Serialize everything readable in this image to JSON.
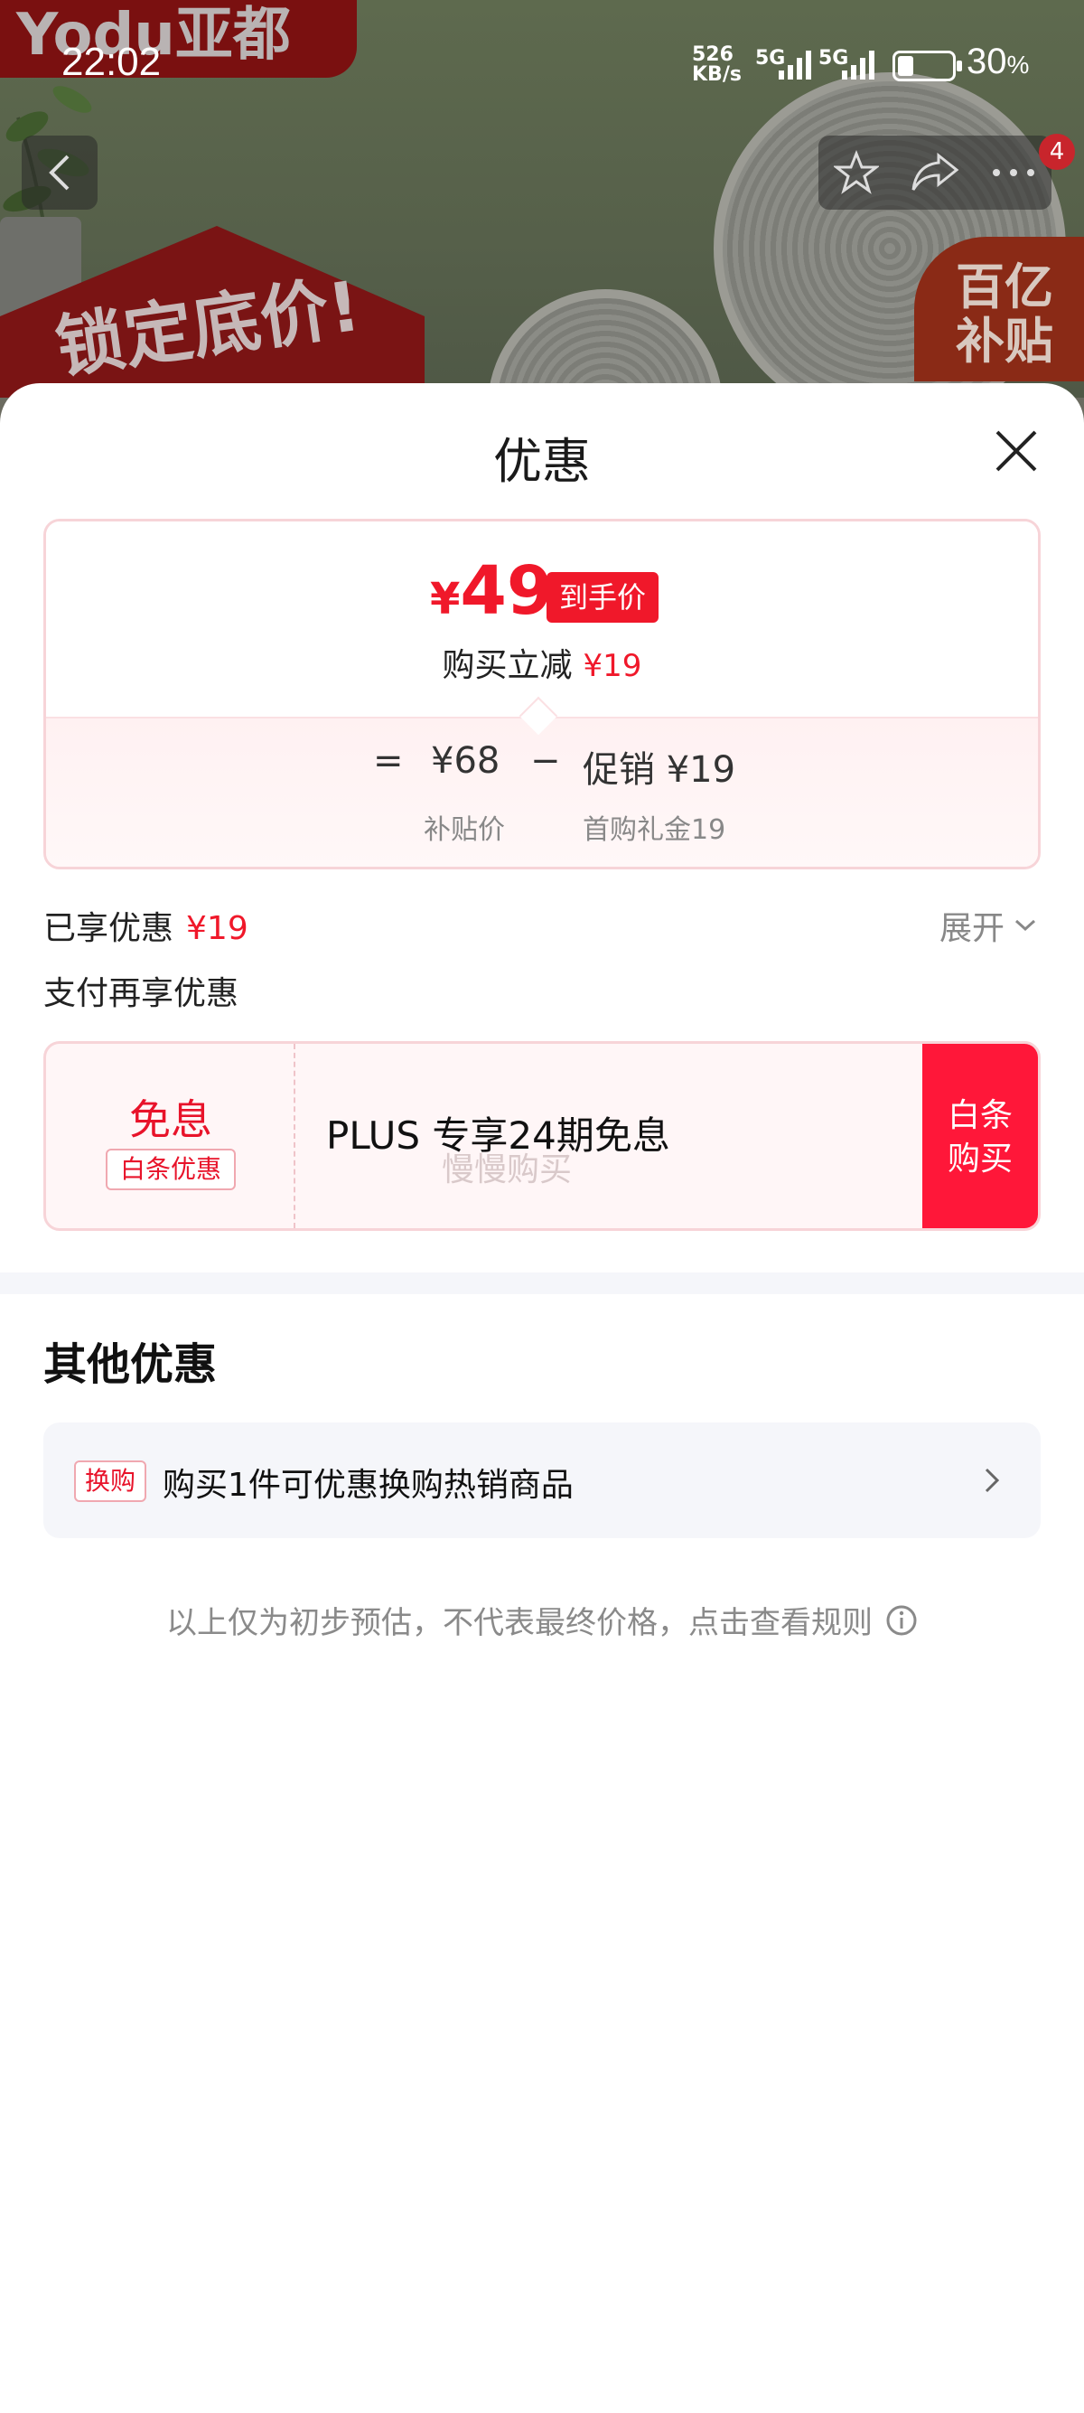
{
  "status_bar": {
    "time": "22:02",
    "net_speed_top": "526",
    "net_speed_bottom": "KB/s",
    "sim1": "5G",
    "sim2": "5G",
    "battery": "30",
    "battery_unit": "%",
    "battery_level": 0.3
  },
  "background": {
    "brand_logo": "Yodu亚都",
    "promo_text": "锁定底价!",
    "subsidy_badge_line1": "百亿",
    "subsidy_badge_line2": "补贴"
  },
  "nav": {
    "cart_badge": "4"
  },
  "sheet": {
    "title": "优惠",
    "price_card": {
      "yen": "¥",
      "final_price": "49",
      "final_tag": "到手价",
      "reduce_label": "购买立减",
      "reduce_amount": "¥19",
      "equals": "=",
      "original_price": "¥68",
      "original_label": "补贴价",
      "minus": "−",
      "promo_label": "促销 ¥19",
      "promo_sub": "首购礼金19"
    },
    "enjoyed_label": "已享优惠",
    "enjoyed_amount": "¥19",
    "expand_label": "展开",
    "pay_more_label": "支付再享优惠",
    "plus_card": {
      "title": "免息",
      "tag": "白条优惠",
      "text": "PLUS 专享24期免息",
      "watermark": "慢慢购买",
      "button_line1": "白条",
      "button_line2": "购买"
    },
    "other_title": "其他优惠",
    "swap": {
      "tag": "换购",
      "text": "购买1件可优惠换购热销商品"
    },
    "footnote": "以上仅为初步预估，不代表最终价格，点击查看规则"
  }
}
